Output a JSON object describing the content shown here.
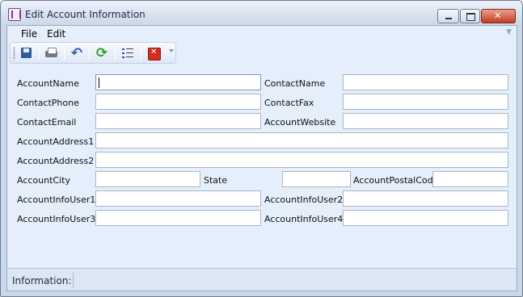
{
  "window": {
    "title": "Edit Account Information"
  },
  "menu": {
    "file": "File",
    "edit": "Edit"
  },
  "toolbar": {
    "buttons": [
      "save-icon",
      "print-icon",
      "undo-icon",
      "refresh-icon",
      "list-icon",
      "close-icon"
    ]
  },
  "form": {
    "account_name": {
      "label": "AccountName",
      "value": ""
    },
    "contact_name": {
      "label": "ContactName",
      "value": ""
    },
    "contact_phone": {
      "label": "ContactPhone",
      "value": ""
    },
    "contact_fax": {
      "label": "ContactFax",
      "value": ""
    },
    "contact_email": {
      "label": "ContactEmail",
      "value": ""
    },
    "account_website": {
      "label": "AccountWebsite",
      "value": ""
    },
    "account_address1": {
      "label": "AccountAddress1",
      "value": ""
    },
    "account_address2": {
      "label": "AccountAddress2",
      "value": ""
    },
    "account_city": {
      "label": "AccountCity",
      "value": ""
    },
    "state": {
      "label": "State",
      "value": ""
    },
    "account_postal_code": {
      "label": "AccountPostalCode",
      "value": ""
    },
    "account_info_user1": {
      "label": "AccountInfoUser1",
      "value": ""
    },
    "account_info_user2": {
      "label": "AccountInfoUser2",
      "value": ""
    },
    "account_info_user3": {
      "label": "AccountInfoUser3",
      "value": ""
    },
    "account_info_user4": {
      "label": "AccountInfoUser4",
      "value": ""
    }
  },
  "status": {
    "label": "Information:"
  },
  "colors": {
    "client_bg": "#e5eefb",
    "close_button": "#c23b22"
  }
}
